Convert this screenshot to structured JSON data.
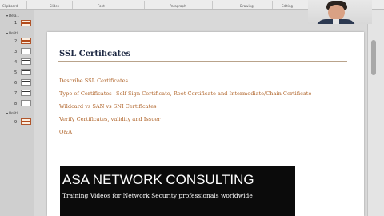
{
  "ribbon": {
    "labels": [
      "Clipboard",
      "Slides",
      "Font",
      "Paragraph",
      "Drawing",
      "Editing"
    ]
  },
  "sidebar": {
    "sections": [
      {
        "label": "Defa...",
        "slides": [
          1
        ]
      },
      {
        "label": "Untitl...",
        "slides": [
          2,
          3,
          4,
          5,
          6,
          7,
          8
        ]
      },
      {
        "label": "Untitl...",
        "slides": [
          9
        ]
      }
    ]
  },
  "slide": {
    "title": "SSL Certificates",
    "bullets": [
      "Describe SSL Certificates",
      "Type of Certificates –Self-Sign Certificate, Root Certificate and Intermediate/Chain Certificate",
      "Wildcard vs SAN vs SNI Certificates",
      "Verify Certificates, validity and Issuer",
      "Q&A"
    ]
  },
  "banner": {
    "title": "ASA NETWORK CONSULTING",
    "subtitle": "Training Videos for Network Security professionals worldwide"
  },
  "colors": {
    "accent": "#b0652b",
    "title": "#1f2a44",
    "banner_bg": "#0b0b0b"
  }
}
